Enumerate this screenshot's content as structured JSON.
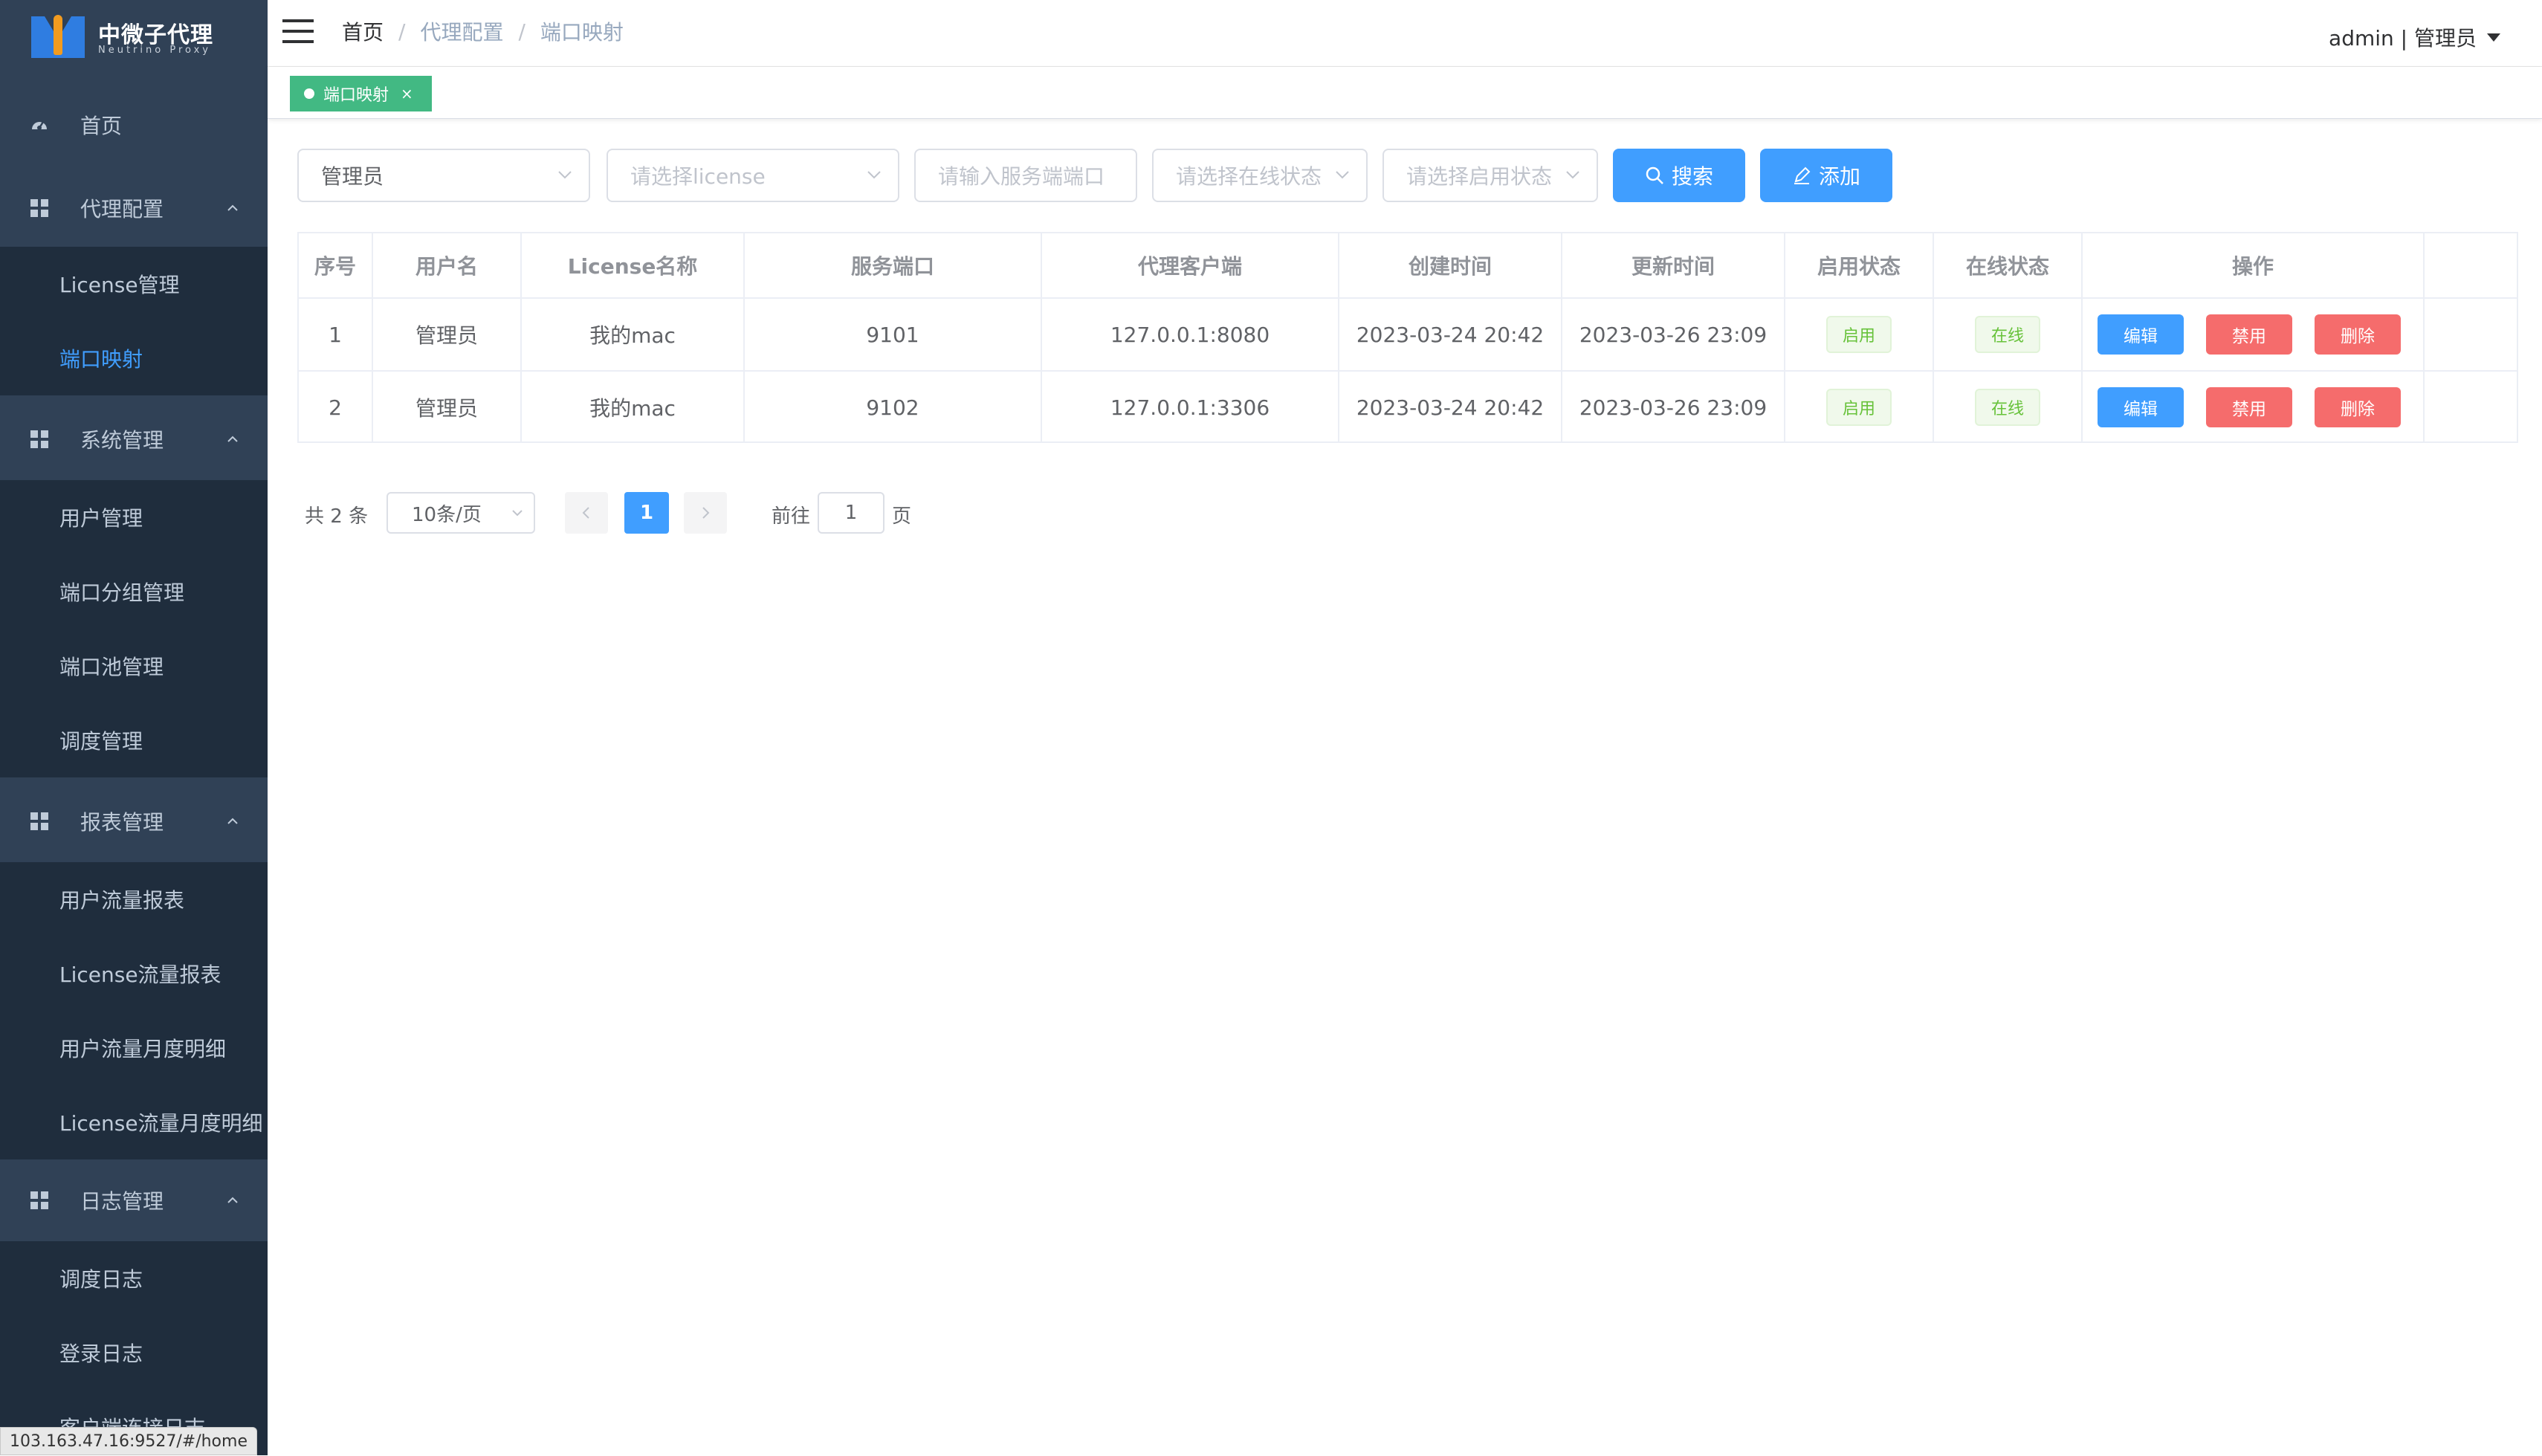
{
  "app": {
    "logo_title": "中微子代理",
    "logo_subtitle": "Neutrino Proxy",
    "status_url": "103.163.47.16:9527/#/home"
  },
  "sidebar": {
    "home": "首页",
    "groups": [
      {
        "label": "代理配置",
        "items": [
          "License管理",
          "端口映射"
        ]
      },
      {
        "label": "系统管理",
        "items": [
          "用户管理",
          "端口分组管理",
          "端口池管理",
          "调度管理"
        ]
      },
      {
        "label": "报表管理",
        "items": [
          "用户流量报表",
          "License流量报表",
          "用户流量月度明细",
          "License流量月度明细"
        ]
      },
      {
        "label": "日志管理",
        "items": [
          "调度日志",
          "登录日志",
          "客户端连接日志"
        ]
      }
    ],
    "active_item": "端口映射"
  },
  "header": {
    "breadcrumb": [
      "首页",
      "代理配置",
      "端口映射"
    ],
    "breadcrumb_sep": "/",
    "user": "admin | 管理员"
  },
  "tags_view": {
    "active_tag": "端口映射",
    "close": "×"
  },
  "filters": {
    "user_value": "管理员",
    "license_placeholder": "请选择license",
    "port_placeholder": "请输入服务端端口",
    "online_placeholder": "请选择在线状态",
    "enable_placeholder": "请选择启用状态",
    "search_label": "搜索",
    "add_label": "添加"
  },
  "table": {
    "headers": [
      "序号",
      "用户名",
      "License名称",
      "服务端口",
      "代理客户端",
      "创建时间",
      "更新时间",
      "启用状态",
      "在线状态",
      "操作"
    ],
    "rows": [
      {
        "index": "1",
        "user": "管理员",
        "license": "我的mac",
        "port": "9101",
        "client": "127.0.0.1:8080",
        "created": "2023-03-24 20:42",
        "updated": "2023-03-26 23:09",
        "enabled": "启用",
        "online": "在线"
      },
      {
        "index": "2",
        "user": "管理员",
        "license": "我的mac",
        "port": "9102",
        "client": "127.0.0.1:3306",
        "created": "2023-03-24 20:42",
        "updated": "2023-03-26 23:09",
        "enabled": "启用",
        "online": "在线"
      }
    ],
    "actions": {
      "edit": "编辑",
      "disable": "禁用",
      "delete": "删除"
    }
  },
  "pagination": {
    "total": "共 2 条",
    "page_size": "10条/页",
    "current_page": "1",
    "goto_label": "前往",
    "goto_value": "1",
    "goto_unit": "页"
  },
  "colors": {
    "sidebar_bg": "#304156",
    "submenu_bg": "#1f2d3d",
    "primary": "#409eff",
    "danger": "#f56c6c",
    "success": "#67c23a",
    "tag_green": "#42b983"
  }
}
